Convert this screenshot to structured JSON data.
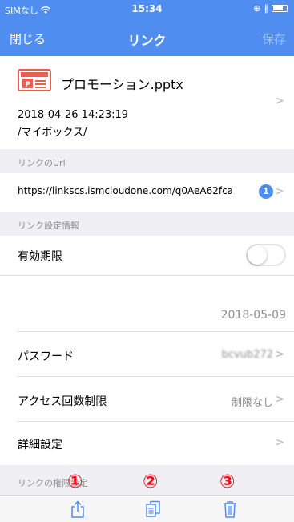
{
  "statusbar": {
    "carrier": "SIMなし",
    "time": "15:34",
    "icons": [
      "wifi-icon",
      "alarm-icon",
      "bluetooth-icon",
      "battery-icon"
    ]
  },
  "navbar": {
    "close_label": "閉じる",
    "title": "リンク",
    "save_label": "保存"
  },
  "file": {
    "name": "プロモーション.pptx",
    "date": "2018-04-26 14:23:19",
    "path": "/マイボックス/",
    "icon": "pptx-file-icon"
  },
  "sections": {
    "link_url_header": "リンクのUrl",
    "link_settings_header": "リンク設定情報",
    "link_permission_header": "リンクの権限設定"
  },
  "link": {
    "url": "https://linkscs.ismcloudone.com/q0AeA62fca",
    "badge": "1"
  },
  "settings": {
    "expiry_label": "有効期限",
    "expiry_enabled": false,
    "expiry_date": "2018-05-09",
    "password_label": "パスワード",
    "password_value": "bcvub272",
    "access_limit_label": "アクセス回数制限",
    "access_limit_value": "制限なし",
    "detail_label": "詳細設定"
  },
  "annotations": {
    "n1": "①",
    "n2": "②",
    "n3": "③"
  },
  "colors": {
    "accent": "#4f8ef0",
    "annotation": "#e8131b",
    "ppt": "#e8604c"
  },
  "toolbar": {
    "icons": [
      "share-icon",
      "copy-icon",
      "trash-icon"
    ]
  }
}
